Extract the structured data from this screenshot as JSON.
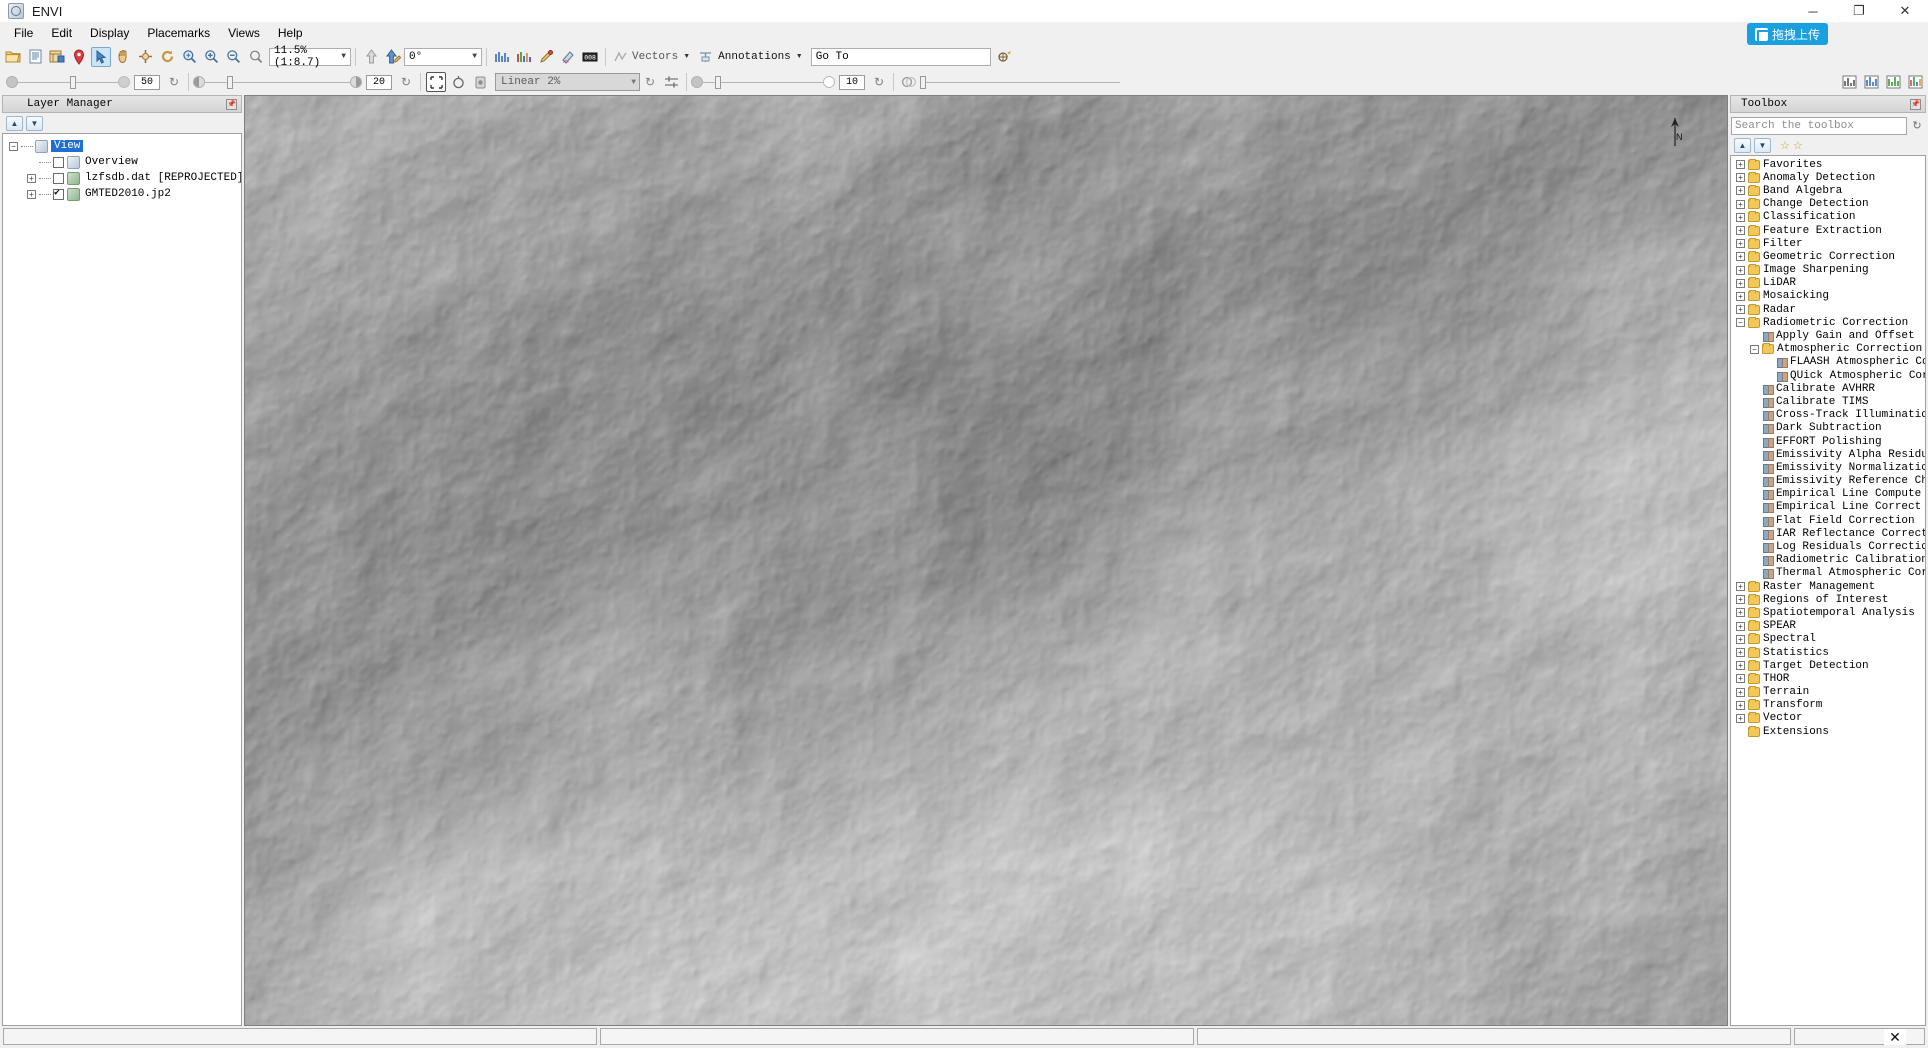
{
  "window": {
    "title": "ENVI",
    "app_icon": "envi-logo-icon",
    "minimize": "─",
    "maximize": "❐",
    "close": "✕"
  },
  "overlay": {
    "upload_label": "拖拽上传",
    "icon": "upload-icon"
  },
  "menu": {
    "items": [
      {
        "label": "File",
        "name": "menu-file"
      },
      {
        "label": "Edit",
        "name": "menu-edit"
      },
      {
        "label": "Display",
        "name": "menu-display"
      },
      {
        "label": "Placemarks",
        "name": "menu-placemarks"
      },
      {
        "label": "Views",
        "name": "menu-views"
      },
      {
        "label": "Help",
        "name": "menu-help"
      }
    ]
  },
  "toolbar1": {
    "buttons": [
      {
        "name": "open-file-button",
        "icon": "folder-open-icon",
        "selected": false
      },
      {
        "name": "open-recent-button",
        "icon": "document-icon",
        "selected": false
      },
      {
        "name": "data-manager-button",
        "icon": "data-manager-icon",
        "selected": false
      },
      {
        "name": "placemark-button",
        "icon": "map-pin-icon",
        "selected": false
      },
      {
        "name": "select-tool-button",
        "icon": "cursor-arrow-icon",
        "selected": true
      },
      {
        "name": "pan-tool-button",
        "icon": "hand-icon",
        "selected": false
      },
      {
        "name": "crosshair-button",
        "icon": "crosshair-icon",
        "selected": false
      },
      {
        "name": "rotate-button",
        "icon": "rotate-icon",
        "selected": false
      },
      {
        "name": "zoom-to-fit-button",
        "icon": "fit-window-icon",
        "selected": false
      },
      {
        "name": "zoom-in-button",
        "icon": "zoom-in-icon",
        "selected": false
      },
      {
        "name": "zoom-out-button",
        "icon": "zoom-out-icon",
        "selected": false
      },
      {
        "name": "zoom-custom-button",
        "icon": "zoom-select-icon",
        "selected": false
      }
    ],
    "zoom_value": "11.5% (1:8.7)",
    "rotate_buttons": [
      {
        "name": "north-up-button",
        "icon": "arrow-up-icon"
      },
      {
        "name": "rotate-north-button",
        "icon": "arrow-up-pencil-icon"
      }
    ],
    "rotation_value": "0°",
    "tool_buttons": [
      {
        "name": "spectral-profile-button",
        "icon": "spectrum-blue-icon"
      },
      {
        "name": "multi-profile-button",
        "icon": "spectrum-color-icon"
      },
      {
        "name": "region-of-interest-button",
        "icon": "roi-pen-icon"
      },
      {
        "name": "roi-tool-button",
        "icon": "roi-tool-icon"
      },
      {
        "name": "pixel-value-button",
        "icon": "pixel-values-icon"
      }
    ],
    "vectors_label": "Vectors",
    "vectors_icon": "vectors-icon",
    "annotations_label": "Annotations",
    "annotations_icon": "annotations-icon",
    "goto_value": "Go To",
    "goto_button": {
      "name": "goto-button",
      "icon": "goto-target-icon"
    }
  },
  "toolbar2": {
    "transparency_value": "50",
    "transparency_refresh": "↻",
    "brightness_value": "20",
    "brightness_refresh": "↻",
    "portal_buttons": [
      {
        "name": "portal-button",
        "icon": "portal-frame-icon",
        "selected": true
      },
      {
        "name": "portal-blend-button",
        "icon": "portal-blend-icon",
        "selected": false
      },
      {
        "name": "portal-flicker-button",
        "icon": "portal-flicker-icon",
        "selected": false
      }
    ],
    "stretch_value": "Linear 2%",
    "stretch_refresh": "↻",
    "stretch_settings": {
      "name": "stretch-settings-button",
      "icon": "sliders-icon"
    },
    "sharpen_value": "10",
    "sharpen_refresh": "↻",
    "right_buttons": [
      {
        "name": "blend-layers-button",
        "icon": "blend-circles-icon"
      },
      {
        "name": "chart-button-1",
        "icon": "histogram-icon"
      },
      {
        "name": "chart-button-2",
        "icon": "chart-blue-icon"
      },
      {
        "name": "chart-button-3",
        "icon": "chart-green-icon"
      },
      {
        "name": "chart-button-4",
        "icon": "chart-multi-icon"
      }
    ]
  },
  "layer_manager": {
    "title": "Layer Manager",
    "pin_icon": "pin-icon",
    "move_up": "▲",
    "move_down": "▼",
    "tree": [
      {
        "label": "View",
        "indent": 0,
        "expander": "−",
        "checkbox": null,
        "icon": "view-icon",
        "selected": true
      },
      {
        "label": "Overview",
        "indent": 1,
        "expander": null,
        "checkbox": false,
        "icon": "overview-icon",
        "selected": false
      },
      {
        "label": "lzfsdb.dat [REPROJECTED]",
        "indent": 1,
        "expander": "+",
        "checkbox": false,
        "icon": "raster-icon",
        "selected": false
      },
      {
        "label": "GMTED2010.jp2",
        "indent": 1,
        "expander": "+",
        "checkbox": true,
        "icon": "raster-icon",
        "selected": false
      }
    ]
  },
  "view": {
    "north_arrow": {
      "name": "north-arrow",
      "label": "N"
    }
  },
  "toolbox": {
    "title": "Toolbox",
    "pin_icon": "pin-icon",
    "search_placeholder": "Search the toolbox",
    "search_value": "",
    "search_refresh_icon": "refresh-icon",
    "tools": [
      {
        "name": "collapse-all-button",
        "icon": "collapse-up-icon"
      },
      {
        "name": "expand-all-button",
        "icon": "expand-down-icon"
      },
      {
        "name": "add-favorite-button",
        "icon": "star-outline-icon"
      },
      {
        "name": "manage-favorites-button",
        "icon": "star-icon"
      }
    ],
    "tree": [
      {
        "label": "Favorites",
        "indent": 0,
        "type": "folder",
        "expander": "+"
      },
      {
        "label": "Anomaly Detection",
        "indent": 0,
        "type": "folder",
        "expander": "+"
      },
      {
        "label": "Band Algebra",
        "indent": 0,
        "type": "folder",
        "expander": "+"
      },
      {
        "label": "Change Detection",
        "indent": 0,
        "type": "folder",
        "expander": "+"
      },
      {
        "label": "Classification",
        "indent": 0,
        "type": "folder",
        "expander": "+"
      },
      {
        "label": "Feature Extraction",
        "indent": 0,
        "type": "folder",
        "expander": "+"
      },
      {
        "label": "Filter",
        "indent": 0,
        "type": "folder",
        "expander": "+"
      },
      {
        "label": "Geometric Correction",
        "indent": 0,
        "type": "folder",
        "expander": "+"
      },
      {
        "label": "Image Sharpening",
        "indent": 0,
        "type": "folder",
        "expander": "+"
      },
      {
        "label": "LiDAR",
        "indent": 0,
        "type": "folder",
        "expander": "+"
      },
      {
        "label": "Mosaicking",
        "indent": 0,
        "type": "folder",
        "expander": "+"
      },
      {
        "label": "Radar",
        "indent": 0,
        "type": "folder",
        "expander": "+"
      },
      {
        "label": "Radiometric Correction",
        "indent": 0,
        "type": "folder",
        "expander": "−"
      },
      {
        "label": "Apply Gain and Offset",
        "indent": 1,
        "type": "tool",
        "expander": null
      },
      {
        "label": "Atmospheric Correction Modul",
        "indent": 1,
        "type": "folder",
        "expander": "−"
      },
      {
        "label": "FLAASH Atmospheric Correc",
        "indent": 2,
        "type": "tool",
        "expander": null
      },
      {
        "label": "QUick Atmospheric Correct",
        "indent": 2,
        "type": "tool",
        "expander": null
      },
      {
        "label": "Calibrate AVHRR",
        "indent": 1,
        "type": "tool",
        "expander": null
      },
      {
        "label": "Calibrate TIMS",
        "indent": 1,
        "type": "tool",
        "expander": null
      },
      {
        "label": "Cross-Track Illumination Cor",
        "indent": 1,
        "type": "tool",
        "expander": null
      },
      {
        "label": "Dark Subtraction",
        "indent": 1,
        "type": "tool",
        "expander": null
      },
      {
        "label": "EFFORT Polishing",
        "indent": 1,
        "type": "tool",
        "expander": null
      },
      {
        "label": "Emissivity Alpha Residuals",
        "indent": 1,
        "type": "tool",
        "expander": null
      },
      {
        "label": "Emissivity Normalization",
        "indent": 1,
        "type": "tool",
        "expander": null
      },
      {
        "label": "Emissivity Reference Channel",
        "indent": 1,
        "type": "tool",
        "expander": null
      },
      {
        "label": "Empirical Line Compute Facto",
        "indent": 1,
        "type": "tool",
        "expander": null
      },
      {
        "label": "Empirical Line Correct Using",
        "indent": 1,
        "type": "tool",
        "expander": null
      },
      {
        "label": "Flat Field Correction",
        "indent": 1,
        "type": "tool",
        "expander": null
      },
      {
        "label": "IAR Reflectance Correction",
        "indent": 1,
        "type": "tool",
        "expander": null
      },
      {
        "label": "Log Residuals Correction",
        "indent": 1,
        "type": "tool",
        "expander": null
      },
      {
        "label": "Radiometric Calibration",
        "indent": 1,
        "type": "tool",
        "expander": null
      },
      {
        "label": "Thermal Atmospheric Correcti",
        "indent": 1,
        "type": "tool",
        "expander": null
      },
      {
        "label": "Raster Management",
        "indent": 0,
        "type": "folder",
        "expander": "+"
      },
      {
        "label": "Regions of Interest",
        "indent": 0,
        "type": "folder",
        "expander": "+"
      },
      {
        "label": "Spatiotemporal Analysis",
        "indent": 0,
        "type": "folder",
        "expander": "+"
      },
      {
        "label": "SPEAR",
        "indent": 0,
        "type": "folder",
        "expander": "+"
      },
      {
        "label": "Spectral",
        "indent": 0,
        "type": "folder",
        "expander": "+"
      },
      {
        "label": "Statistics",
        "indent": 0,
        "type": "folder",
        "expander": "+"
      },
      {
        "label": "Target Detection",
        "indent": 0,
        "type": "folder",
        "expander": "+"
      },
      {
        "label": "THOR",
        "indent": 0,
        "type": "folder",
        "expander": "+"
      },
      {
        "label": "Terrain",
        "indent": 0,
        "type": "folder",
        "expander": "+"
      },
      {
        "label": "Transform",
        "indent": 0,
        "type": "folder",
        "expander": "+"
      },
      {
        "label": "Vector",
        "indent": 0,
        "type": "folder",
        "expander": "+"
      },
      {
        "label": "Extensions",
        "indent": 0,
        "type": "folder",
        "expander": null
      }
    ]
  },
  "statusbar": {
    "panel1": "",
    "panel2": "",
    "panel3": "",
    "panel4": "",
    "close_label": "✕"
  }
}
